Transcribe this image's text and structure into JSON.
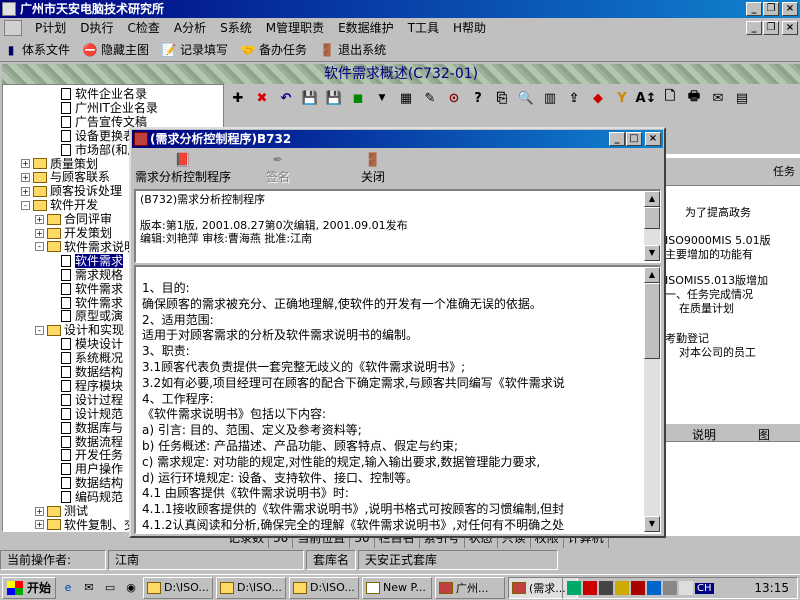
{
  "app": {
    "title": "广州市天安电脑技术研究所"
  },
  "menu": [
    "P计划",
    "D执行",
    "C检查",
    "A分析",
    "S系统",
    "M管理职责",
    "E数据维护",
    "T工具",
    "H帮助"
  ],
  "toolbar1": [
    {
      "label": "体系文件",
      "icon": "book-icon"
    },
    {
      "label": "隐藏主图",
      "icon": "no-entry-icon"
    },
    {
      "label": "记录填写",
      "icon": "notepad-icon"
    },
    {
      "label": "备办任务",
      "icon": "handshake-icon"
    },
    {
      "label": "退出系统",
      "icon": "exit-icon"
    }
  ],
  "banner": "软件需求概述(C732-01)",
  "tree": [
    {
      "label": "软件企业名录",
      "level": 3,
      "type": "doc"
    },
    {
      "label": "广州IT企业名录",
      "level": 3,
      "type": "doc"
    },
    {
      "label": "广告宣传文稿",
      "level": 3,
      "type": "doc"
    },
    {
      "label": "设备更换表",
      "level": 3,
      "type": "doc"
    },
    {
      "label": "市场部(和质",
      "level": 3,
      "type": "doc"
    },
    {
      "label": "质量策划",
      "level": 1,
      "type": "folder",
      "expand": "+"
    },
    {
      "label": "与顾客联系",
      "level": 1,
      "type": "folder",
      "expand": "+"
    },
    {
      "label": "顾客投诉处理",
      "level": 1,
      "type": "folder",
      "expand": "+"
    },
    {
      "label": "软件开发",
      "level": 1,
      "type": "folder",
      "expand": "-"
    },
    {
      "label": "合同评审",
      "level": 2,
      "type": "folder",
      "expand": "+"
    },
    {
      "label": "开发策划",
      "level": 2,
      "type": "folder",
      "expand": "+"
    },
    {
      "label": "软件需求说明",
      "level": 2,
      "type": "folder",
      "expand": "-"
    },
    {
      "label": "软件需求",
      "level": 3,
      "type": "doc",
      "selected": true
    },
    {
      "label": "需求规格",
      "level": 3,
      "type": "doc"
    },
    {
      "label": "软件需求",
      "level": 3,
      "type": "doc"
    },
    {
      "label": "软件需求",
      "level": 3,
      "type": "doc"
    },
    {
      "label": "原型或演",
      "level": 3,
      "type": "doc"
    },
    {
      "label": "设计和实现",
      "level": 2,
      "type": "folder",
      "expand": "-"
    },
    {
      "label": "模块设计",
      "level": 3,
      "type": "doc"
    },
    {
      "label": "系统概况",
      "level": 3,
      "type": "doc"
    },
    {
      "label": "数据结构",
      "level": 3,
      "type": "doc"
    },
    {
      "label": "程序模块",
      "level": 3,
      "type": "doc"
    },
    {
      "label": "设计过程",
      "level": 3,
      "type": "doc"
    },
    {
      "label": "设计规范",
      "level": 3,
      "type": "doc"
    },
    {
      "label": "数据库与",
      "level": 3,
      "type": "doc"
    },
    {
      "label": "数据流程",
      "level": 3,
      "type": "doc"
    },
    {
      "label": "开发任务",
      "level": 3,
      "type": "doc"
    },
    {
      "label": "用户操作",
      "level": 3,
      "type": "doc"
    },
    {
      "label": "数据结构",
      "level": 3,
      "type": "doc"
    },
    {
      "label": "编码规范",
      "level": 3,
      "type": "doc"
    },
    {
      "label": "测试",
      "level": 2,
      "type": "folder",
      "expand": "+"
    },
    {
      "label": "软件复制、交",
      "level": 2,
      "type": "folder",
      "expand": "+"
    }
  ],
  "bggrid": {
    "header": "任务",
    "lines": [
      "为了提高政务",
      "ISO9000MIS 5.01版",
      "主要增加的功能有",
      "ISOMIS5.013版增加",
      "一、任务完成情况",
      "在质量计划",
      "考勤登记",
      "对本公司的员工"
    ],
    "header2_a": "说明",
    "header2_b": "图"
  },
  "status1": [
    "记录数",
    "30",
    "当前位置",
    "30",
    "栏目名",
    "索引号",
    "状态",
    "只读",
    "权限",
    "计算机"
  ],
  "status2": {
    "operator_label": "当前操作者:",
    "operator": "江南",
    "library_label": "套库名",
    "library": "天安正式套库"
  },
  "taskbar": {
    "start": "开始",
    "tasks": [
      "D:\\ISO...",
      "D:\\ISO...",
      "D:\\ISO...",
      "New P...",
      "广州...",
      "(需求..."
    ],
    "clock": "13:15",
    "ime": "CH"
  },
  "dialog": {
    "title": "(需求分析控制程序)B732",
    "buttons": [
      {
        "label": "需求分析控制程序",
        "icon": "book-icon",
        "enabled": true
      },
      {
        "label": "签名",
        "icon": "pen-icon",
        "enabled": false
      },
      {
        "label": "关闭",
        "icon": "door-icon",
        "enabled": true
      }
    ],
    "info": {
      "line1": "(B732)需求分析控制程序",
      "line2": "版本:第1版, 2001.08.27第0次编辑, 2001.09.01发布",
      "line3": "编辑:刘艳萍 审核:曹海燕 批准:江南"
    },
    "body": [
      "1、目的:",
      "确保顾客的需求被充分、正确地理解,使软件的开发有一个准确无误的依据。",
      "2、适用范围:",
      "适用于对顾客需求的分析及软件需求说明书的编制。",
      "3、职责:",
      "3.1顾客代表负责提供一套完整无歧义的《软件需求说明书》;",
      "3.2如有必要,项目经理可在顾客的配合下确定需求,与顾客共同编写《软件需求说",
      "4、工作程序:",
      "《软件需求说明书》包括以下内容:",
      "a) 引言: 目的、范围、定义及参考资料等;",
      "b) 任务概述: 产品描述、产品功能、顾客特点、假定与约束;",
      "c) 需求规定: 对功能的规定,对性能的规定,输入输出要求,数据管理能力要求,",
      "d) 运行环境规定: 设备、支持软件、接口、控制等。",
      "4.1 由顾客提供《软件需求说明书》时:",
      "4.1.1接收顾客提供的《软件需求说明书》,说明书格式可按顾客的习惯编制,但封",
      "4.1.2认真阅读和分析,确保完全的理解《软件需求说明书》,对任何有不明确之处"
    ]
  }
}
